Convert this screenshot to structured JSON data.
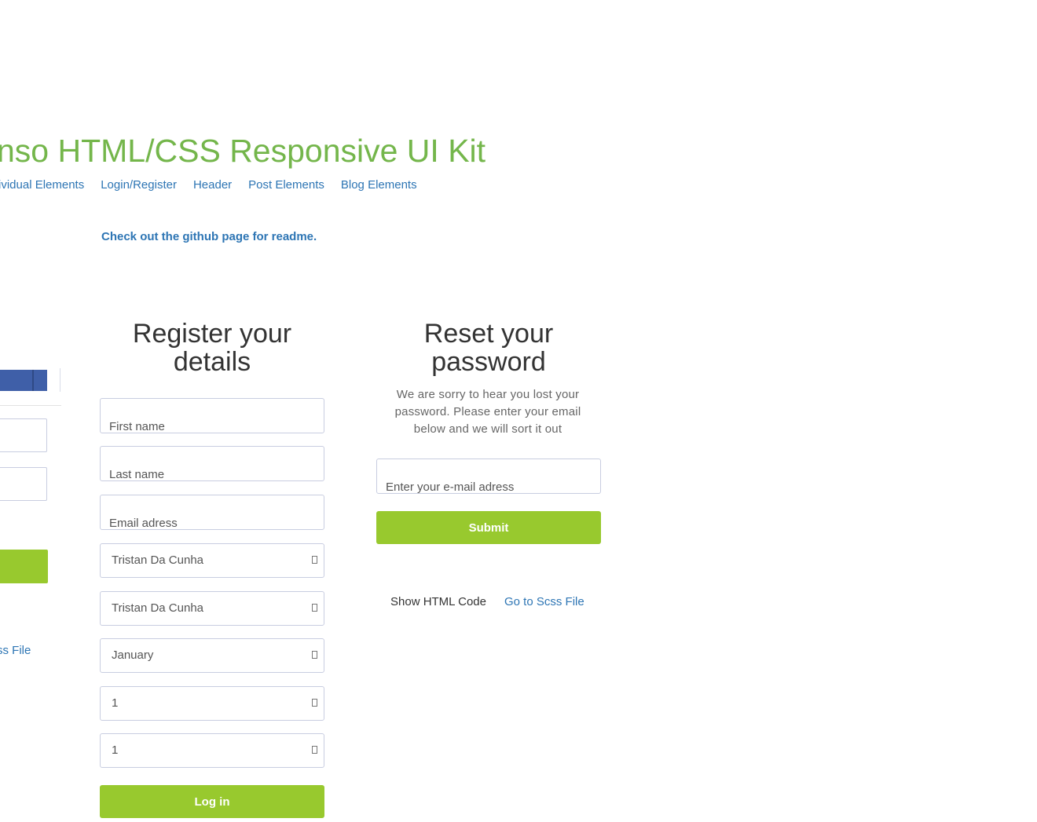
{
  "header": {
    "title": "nso HTML/CSS Responsive UI Kit",
    "nav": [
      "ividual Elements",
      "Login/Register",
      "Header",
      "Post Elements",
      "Blog Elements"
    ],
    "readme_link": "Check out the github page for readme."
  },
  "left_column": {
    "scss_link": "ss File"
  },
  "register": {
    "title": "Register your details",
    "first_name_placeholder": "First name",
    "last_name_placeholder": "Last name",
    "email_placeholder": "Email adress",
    "selects": [
      "Tristan Da Cunha",
      "Tristan Da Cunha",
      "January",
      "1",
      "1"
    ],
    "submit_label": "Log in"
  },
  "reset": {
    "title": "Reset your password",
    "description": "We are sorry to hear you lost your password. Please enter your email below and we will sort it out",
    "email_placeholder": "Enter your e-mail adress",
    "submit_label": "Submit",
    "show_code": "Show HTML Code",
    "scss_link": "Go to Scss File"
  },
  "colors": {
    "title_green": "#74b64b",
    "button_green": "#98c92e",
    "link_blue": "#2d75b4",
    "facebook_blue": "#3f5fa8"
  }
}
